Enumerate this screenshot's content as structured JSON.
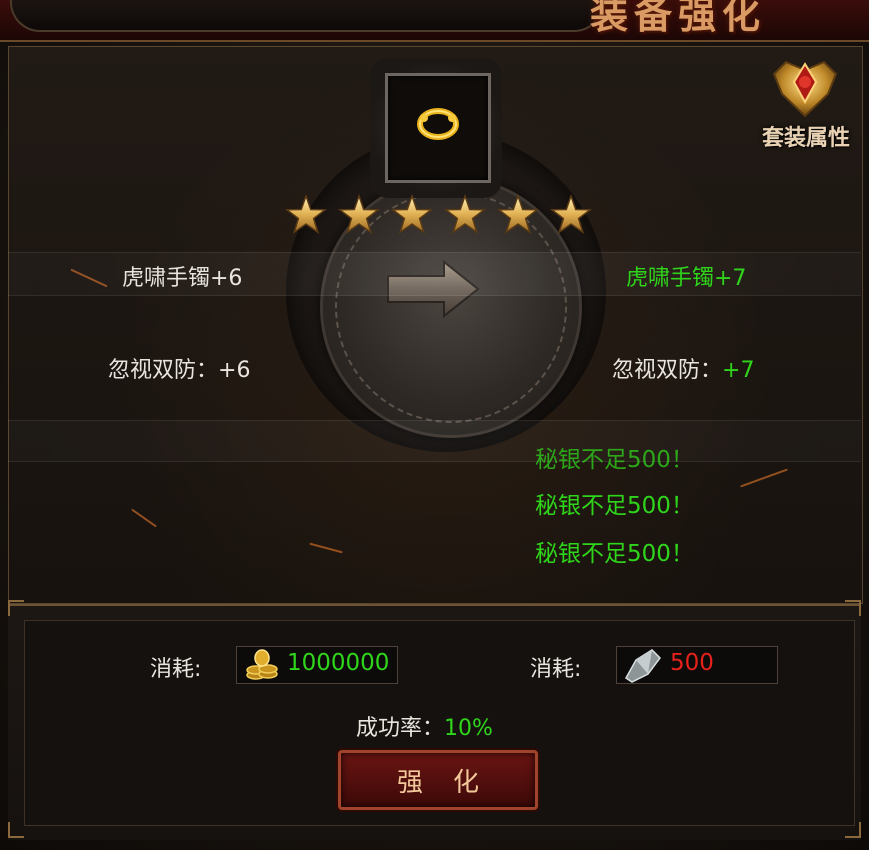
{
  "header": {
    "title": "装备强化"
  },
  "suit": {
    "label": "套装属性",
    "icon": "medal-icon"
  },
  "item": {
    "icon": "golden-ring-icon",
    "stars": 6
  },
  "current": {
    "name": "虎啸手镯+6",
    "stat_label": "忽视双防：",
    "stat_value": "+6"
  },
  "next": {
    "name": "虎啸手镯+7",
    "stat_label": "忽视双防：",
    "stat_value": "+7"
  },
  "messages": [
    "秘银不足500！",
    "秘银不足500！",
    "秘银不足500！"
  ],
  "cost": {
    "gold_label": "消耗:",
    "gold_value": "1000000",
    "gold_icon": "gold-coins-icon",
    "mithril_label": "消耗:",
    "mithril_value": "500",
    "mithril_icon": "mithril-ore-icon"
  },
  "success": {
    "label": "成功率：",
    "value": "10%"
  },
  "button": {
    "label": "强化"
  },
  "colors": {
    "accent_green": "#2fd51b",
    "accent_red": "#e4211a",
    "title_gold": "#d99a63",
    "button_red": "#6a1512"
  }
}
